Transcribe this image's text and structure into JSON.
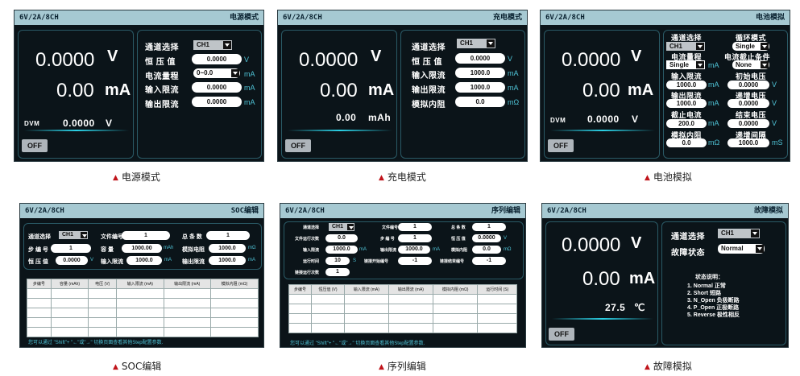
{
  "device": "6V/2A/8CH",
  "captions": [
    "电源模式",
    "充电模式",
    "电池模拟",
    "SOC编辑",
    "序列编辑",
    "故障模拟"
  ],
  "p1": {
    "title": "电源模式",
    "voltage": "0.0000",
    "v_unit": "V",
    "current": "0.00",
    "i_unit": "mA",
    "dvm_label": "DVM",
    "dvm_value": "0.0000",
    "dvm_unit": "V",
    "off": "OFF",
    "labels": [
      "通道选择",
      "恒 压 值",
      "电流量程",
      "输入限流",
      "输出限流"
    ],
    "channel": "CH1",
    "cv": "0.0000",
    "cv_unit": "V",
    "range": "0~0.0",
    "range_unit": "mA",
    "in_limit": "0.0000",
    "in_unit": "mA",
    "out_limit": "0.0000",
    "out_unit": "mA"
  },
  "p2": {
    "title": "充电模式",
    "voltage": "0.0000",
    "v_unit": "V",
    "current": "0.00",
    "i_unit": "mA",
    "cap": "0.00",
    "cap_unit": "mAh",
    "off": "OFF",
    "labels": [
      "通道选择",
      "恒 压 值",
      "输入限流",
      "输出限流",
      "模拟内阻"
    ],
    "channel": "CH1",
    "cv": "0.0000",
    "cv_unit": "V",
    "in_limit": "1000.0",
    "in_unit": "mA",
    "out_limit": "1000.0",
    "out_unit": "mA",
    "res": "0.0",
    "res_unit": "mΩ"
  },
  "p3": {
    "title": "电池模拟",
    "voltage": "0.0000",
    "v_unit": "V",
    "current": "0.00",
    "i_unit": "mA",
    "dvm_label": "DVM",
    "dvm_value": "0.0000",
    "dvm_unit": "V",
    "off": "OFF",
    "l_labels": [
      "通道选择",
      "电流量程",
      "输入限流",
      "输出限流",
      "截止电流",
      "模拟内阻"
    ],
    "r_labels": [
      "循环模式",
      "电流截止条件",
      "初始电压",
      "递增电压",
      "结束电压",
      "递增间隔"
    ],
    "channel": "CH1",
    "range": "Single",
    "range_unit": "mA",
    "in_limit": "1000.0",
    "in_unit": "mA",
    "out_limit": "1000.0",
    "out_unit": "mA",
    "cutoff": "200.0",
    "cutoff_unit": "mA",
    "res": "0.0",
    "res_unit": "mΩ",
    "loop": "Single",
    "cond": "None",
    "init_v": "0.0000",
    "init_unit": "V",
    "step_v": "0.0000",
    "step_unit": "V",
    "end_v": "0.0000",
    "end_unit": "V",
    "interval": "1000.0",
    "interval_unit": "mS"
  },
  "p4": {
    "title": "SOC编辑",
    "row1": [
      "通道选择",
      "CH1",
      "文件编号",
      "1",
      "总 条 数",
      "1"
    ],
    "row2": [
      "步 编 号",
      "1",
      "容   量",
      "1000.00",
      "mAh",
      "模拟电阻",
      "1000.0",
      "mΩ"
    ],
    "row3": [
      "恒 压 值",
      "0.0000",
      "V",
      "输入限流",
      "1000.0",
      "mA",
      "输出限流",
      "1000.0",
      "mA"
    ],
    "headers": [
      "步编号",
      "容量 (mAh)",
      "电压 (V)",
      "输入限流 (mA)",
      "输出限流 (mA)",
      "模拟内阻 (mΩ)"
    ],
    "footer": "您可以通过 \"Shift\"+ \"←\"或\"→\" 切换页面查看其他Step配置参数."
  },
  "p5": {
    "title": "序列编辑",
    "row1": [
      "通道选择",
      "CH1",
      "文件编号",
      "1",
      "总 条 数",
      "1"
    ],
    "row2": [
      "文件运行次数",
      "0.0",
      "步 编 号",
      "1",
      "恒 压 值",
      "0.0000",
      "V"
    ],
    "row3": [
      "输入限流",
      "1000.0",
      "mA",
      "输出限流",
      "1000.0",
      "mA",
      "模拟内阻",
      "0.0",
      "mΩ"
    ],
    "row4": [
      "运行时间",
      "10",
      "S",
      "链接开始编号",
      "-1",
      "链接结束编号",
      "-1"
    ],
    "row5": [
      "链接运行次数",
      "1"
    ],
    "headers": [
      "步编号",
      "恒压值 (V)",
      "输入限流 (mA)",
      "输出限流 (mA)",
      "模拟内阻 (mΩ)",
      "运行时间 (S)"
    ],
    "footer": "您可以通过 \"Shift\"+ \"←\"或\"→\" 切换页面查看其他Step配置参数."
  },
  "p6": {
    "title": "故障模拟",
    "voltage": "0.0000",
    "v_unit": "V",
    "current": "0.00",
    "i_unit": "mA",
    "temp": "27.5",
    "temp_unit": "℃",
    "off": "OFF",
    "labels": [
      "通道选择",
      "故障状态"
    ],
    "channel": "CH1",
    "state": "Normal",
    "note_title": "状态说明：",
    "notes": [
      "1. Normal 正常",
      "2. Short  短路",
      "3. N_Open 负极断路",
      "4. P_Open 正极断路",
      "5. Reverse 极性相反"
    ]
  },
  "colors": {
    "bg": "#0b1419",
    "title": "#a6c9d2",
    "unit": "#4fc3d6",
    "caption_mark": "#c0141b"
  }
}
